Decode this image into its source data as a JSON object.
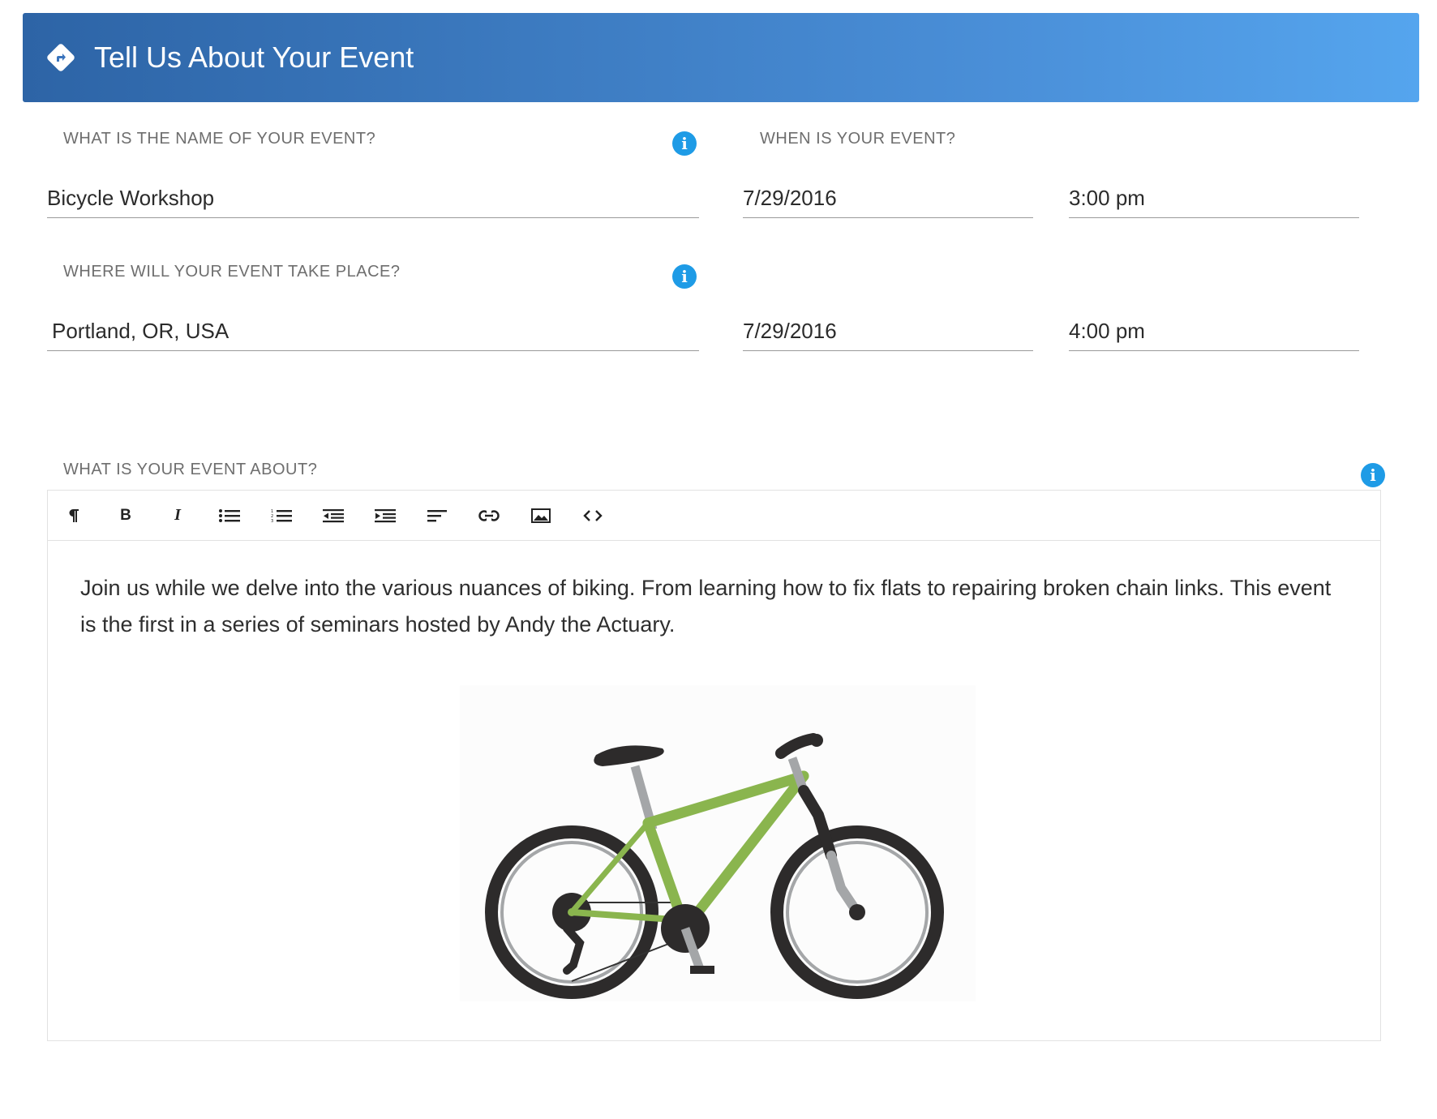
{
  "header": {
    "title": "Tell Us About Your Event",
    "icon": "directions-icon"
  },
  "event_name": {
    "label": "WHAT IS THE NAME OF YOUR EVENT?",
    "value": "Bicycle Workshop"
  },
  "event_when": {
    "label": "WHEN IS YOUR EVENT?",
    "start_date": "7/29/2016",
    "start_time": "3:00 pm",
    "end_date": "7/29/2016",
    "end_time": "4:00 pm"
  },
  "event_location": {
    "label": "WHERE WILL YOUR EVENT TAKE PLACE?",
    "value": "Portland, OR, USA"
  },
  "event_about": {
    "label": "WHAT IS YOUR EVENT ABOUT?",
    "toolbar": [
      "paragraph-icon",
      "bold-icon",
      "italic-icon",
      "bulleted-list-icon",
      "numbered-list-icon",
      "outdent-icon",
      "indent-icon",
      "align-left-icon",
      "link-icon",
      "image-icon",
      "code-icon"
    ],
    "body": "Join us while we delve into the various nuances of biking. From learning how to fix flats to repairing broken chain links. This event is the first in a series of seminars hosted by Andy the Actuary."
  },
  "colors": {
    "header_start": "#2d64a6",
    "header_end": "#55a5ee",
    "info": "#1e9be6",
    "bike_frame": "#8ab54e"
  }
}
